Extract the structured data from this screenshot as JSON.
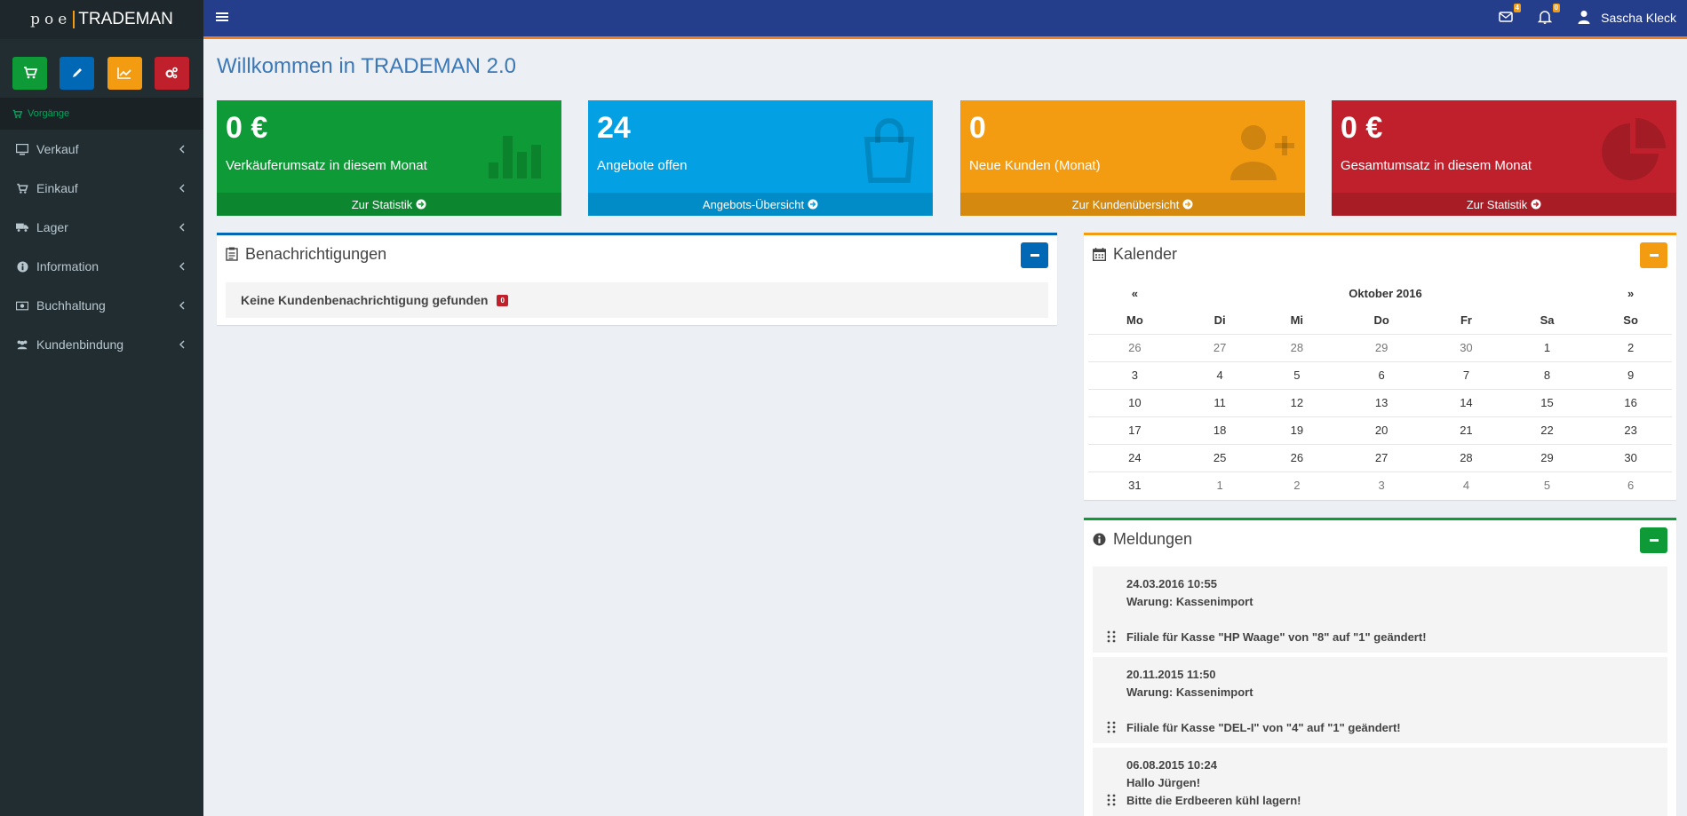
{
  "logo": {
    "poe": "poe",
    "brand": "TRADEMAN"
  },
  "sidebar": {
    "quick_buttons": [
      {
        "icon": "cart-icon",
        "color": "#00a65a"
      },
      {
        "icon": "pencil-icon",
        "color": "#0073b7"
      },
      {
        "icon": "line-chart-icon",
        "color": "#f39c12"
      },
      {
        "icon": "gears-icon",
        "color": "#dd4b39"
      }
    ],
    "vorgaenge": "Vorgänge",
    "items": [
      {
        "label": "Verkauf",
        "icon": "desktop-icon"
      },
      {
        "label": "Einkauf",
        "icon": "cart-icon"
      },
      {
        "label": "Lager",
        "icon": "truck-icon"
      },
      {
        "label": "Information",
        "icon": "info-circle-icon"
      },
      {
        "label": "Buchhaltung",
        "icon": "money-icon"
      },
      {
        "label": "Kundenbindung",
        "icon": "users-icon"
      }
    ]
  },
  "header": {
    "mail_count": "4",
    "bell_count": "0",
    "user_name": "Sascha Kleck"
  },
  "page_title": "Willkommen in TRADEMAN 2.0",
  "tiles": [
    {
      "value": "0 €",
      "label": "Verkäuferumsatz in diesem Monat",
      "link": "Zur Statistik",
      "color": "#00a65a",
      "icon": "bar-chart-icon"
    },
    {
      "value": "24",
      "label": "Angebote offen",
      "link": "Angebots-Übersicht",
      "color": "#00a0e9",
      "icon": "shopping-bag-icon"
    },
    {
      "value": "0",
      "label": "Neue Kunden (Monat)",
      "link": "Zur Kundenübersicht",
      "color": "#f39c12",
      "icon": "user-plus-icon"
    },
    {
      "value": "0 €",
      "label": "Gesamtumsatz in diesem Monat",
      "link": "Zur Statistik",
      "color": "#c0202c",
      "icon": "pie-chart-icon"
    }
  ],
  "notifications": {
    "title": "Benachrichtigungen",
    "empty_text": "Keine Kundenbenachrichtigung gefunden",
    "count": "0"
  },
  "calendar": {
    "title": "Kalender",
    "prev": "«",
    "next": "»",
    "month": "Oktober 2016",
    "weekdays": [
      "Mo",
      "Di",
      "Mi",
      "Do",
      "Fr",
      "Sa",
      "So"
    ],
    "weeks": [
      [
        "26",
        "27",
        "28",
        "29",
        "30",
        "1",
        "2"
      ],
      [
        "3",
        "4",
        "5",
        "6",
        "7",
        "8",
        "9"
      ],
      [
        "10",
        "11",
        "12",
        "13",
        "14",
        "15",
        "16"
      ],
      [
        "17",
        "18",
        "19",
        "20",
        "21",
        "22",
        "23"
      ],
      [
        "24",
        "25",
        "26",
        "27",
        "28",
        "29",
        "30"
      ],
      [
        "31",
        "1",
        "2",
        "3",
        "4",
        "5",
        "6"
      ]
    ]
  },
  "messages": {
    "title": "Meldungen",
    "items": [
      {
        "date": "24.03.2016 10:55",
        "subject": "Warung: Kassenimport",
        "body": "Filiale für Kasse \"HP Waage\" von \"8\" auf \"1\" geändert!"
      },
      {
        "date": "20.11.2015 11:50",
        "subject": "Warung: Kassenimport",
        "body": "Filiale für Kasse \"DEL-I\" von \"4\" auf \"1\" geändert!"
      },
      {
        "date": "06.08.2015 10:24",
        "subject": "Hallo Jürgen!",
        "body": "Bitte die Erdbeeren kühl lagern!"
      }
    ]
  }
}
